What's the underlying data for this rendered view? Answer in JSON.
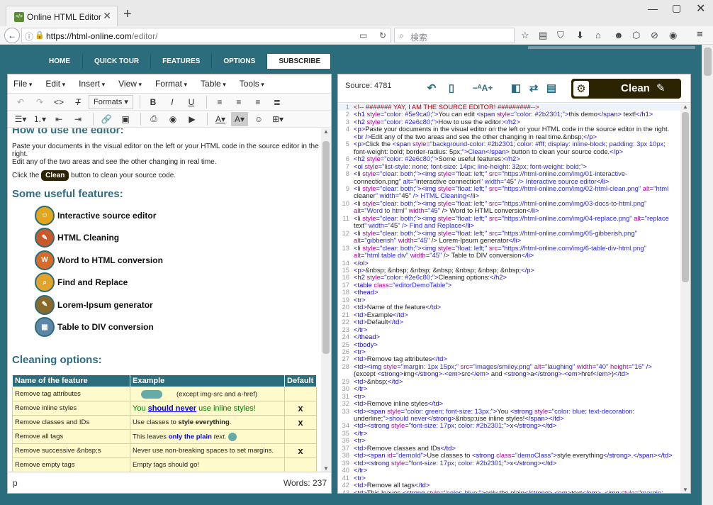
{
  "browser": {
    "tab_title": "Online HTML Editor",
    "url_host": "https://html-online.com",
    "url_path": "/editor/",
    "search_placeholder": "検索"
  },
  "site_nav": [
    "HOME",
    "QUICK TOUR",
    "FEATURES",
    "OPTIONS",
    "SUBSCRIBE"
  ],
  "site_nav_active": "SUBSCRIBE",
  "menubar": [
    "File",
    "Edit",
    "Insert",
    "View",
    "Format",
    "Table",
    "Tools"
  ],
  "toolbar": {
    "formats": "Formats"
  },
  "content": {
    "heading_top": "How to use the editor:",
    "para1": "Paste your documents in the visual editor on the left or your HTML code in the source editor in the right.",
    "para2": "Edit any of the two areas and see the other changing in real time.",
    "click_prefix": "Click the",
    "clean_chip": "Clean",
    "click_suffix": "button to clean your source code.",
    "features_heading": "Some useful features:",
    "features": [
      {
        "label": "Interactive source editor",
        "icon": "interactive-connection-icon"
      },
      {
        "label": "HTML Cleaning",
        "icon": "html-cleaner-icon"
      },
      {
        "label": "Word to HTML conversion",
        "icon": "word-to-html-icon"
      },
      {
        "label": "Find and Replace",
        "icon": "find-replace-icon"
      },
      {
        "label": "Lorem-Ipsum generator",
        "icon": "gibberish-icon"
      },
      {
        "label": "Table to DIV conversion",
        "icon": "table-div-icon"
      }
    ],
    "cleaning_heading": "Cleaning options:",
    "table_headers": [
      "Name of the feature",
      "Example",
      "Default"
    ],
    "table_rows": [
      {
        "name": "Remove tag attributes",
        "example": "(except img-src and a-href)",
        "default": ""
      },
      {
        "name": "Remove inline styles",
        "example_a": "You ",
        "example_b": "should never",
        "example_c": " use inline styles!",
        "default": "x"
      },
      {
        "name": "Remove classes and IDs",
        "example_a": "Use classes to ",
        "example_b": "style everything",
        "example_c": ".",
        "default": "x"
      },
      {
        "name": "Remove all tags",
        "example_a": "This leaves ",
        "example_b": "only the plain",
        "example_c": " text.",
        "default": ""
      },
      {
        "name": "Remove successive &nbsp;s",
        "example": "Never use non-breaking spaces to set margins.",
        "default": "x"
      },
      {
        "name": "Remove empty tags",
        "example": "Empty tags should go!",
        "default": ""
      }
    ],
    "status_path": "p",
    "status_words": "Words: 237"
  },
  "source": {
    "label": "Source: 4781",
    "clean_button": "Clean",
    "lines": [
      "<!-- #######  YAY, I AM THE SOURCE EDITOR! #########-->",
      "<h1 style=\"color: #5e9ca0;\">You can edit <span style=\"color: #2b2301;\">this demo</span> text!</h1>",
      "<h2 style=\"color: #2e6c80;\">How to use the editor:</h2>",
      "<p>Paste your documents in the visual editor on the left or your HTML code in the source editor in the right.",
      "<br />Edit any of the two areas and see the other changing in real time.&nbsp;</p>",
      "<p>Click the <span style=\"background-color: #2b2301; color: #fff; display: inline-block; padding: 3px 10px;",
      "font-weight: bold; border-radius: 5px;\">Clean</span> button to clean your source code.</p>",
      "<h2 style=\"color: #2e6c80;\">Some useful features:</h2>",
      "<ol style=\"list-style: none; font-size: 14px; line-height: 32px; font-weight: bold;\">",
      "<li style=\"clear: both;\"><img style=\"float: left;\" src=\"https://html-online.com/img/01-interactive-",
      "connection.png\" alt=\"interactive connection\" width=\"45\" /> Interactive source editor</li>",
      "<li style=\"clear: both;\"><img style=\"float: left;\" src=\"https://html-online.com/img/02-html-clean.png\" alt=\"html",
      "cleaner\" width=\"45\" /> HTML Cleaning</li>",
      "<li style=\"clear: both;\"><img style=\"float: left;\" src=\"https://html-online.com/img/03-docs-to-html.png\"",
      "alt=\"Word to html\" width=\"45\" /> Word to HTML conversion</li>",
      "<li style=\"clear: both;\"><img style=\"float: left;\" src=\"https://html-online.com/img/04-replace.png\" alt=\"replace",
      "text\" width=\"45\" /> Find and Replace</li>",
      "<li style=\"clear: both;\"><img style=\"float: left;\" src=\"https://html-online.com/img/05-gibberish.png\"",
      "alt=\"gibberish\" width=\"45\" /> Lorem-Ipsum generator</li>",
      "<li style=\"clear: both;\"><img style=\"float: left;\" src=\"https://html-online.com/img/6-table-div-html.png\"",
      "alt=\"html table div\" width=\"45\" /> Table to DIV conversion</li>",
      "</ol>",
      "<p>&nbsp; &nbsp; &nbsp; &nbsp; &nbsp; &nbsp; &nbsp;</p>",
      "<h2 style=\"color: #2e6c80;\">Cleaning options:</h2>",
      "<table class=\"editorDemoTable\">",
      "<thead>",
      "<tr>",
      "<td>Name of the feature</td>",
      "<td>Example</td>",
      "<td>Default</td>",
      "</tr>",
      "</thead>",
      "<tbody>",
      "<tr>",
      "<td>Remove tag attributes</td>",
      "<td><img style=\"margin: 1px 15px;\" src=\"images/smiley.png\" alt=\"laughing\" width=\"40\" height=\"16\" />",
      "(except <strong>img</strong>-<em>src</em> and <strong>a</strong>-<em>href</em>)</td>",
      "<td>&nbsp;</td>",
      "</tr>",
      "<tr>",
      "<td>Remove inline styles</td>",
      "<td><span style=\"color: green; font-size: 13px;\">You <strong style=\"color: blue; text-decoration:",
      "underline;\">should never</strong>&nbsp;use inline styles!</span></td>",
      "<td><strong style=\"font-size: 17px; color: #2b2301;\">x</strong></td>",
      "</tr>",
      "<tr>",
      "<td>Remove classes and IDs</td>",
      "<td><span id=\"demoId\">Use classes to <strong class=\"demoClass\">style everything</strong>.</span></td>",
      "<td><strong style=\"font-size: 17px; color: #2b2301;\">x</strong></td>",
      "</tr>",
      "<tr>",
      "<td>Remove all tags</td>",
      "<td>This leaves <strong style=\"color: blue;\">only the plain</strong> <em>text</em>. <img style=\"margin:"
    ],
    "line_numbers": [
      "1",
      "2",
      "3",
      "4",
      "",
      "5",
      "",
      "6",
      "7",
      "8",
      "",
      "9",
      "",
      "10",
      "",
      "11",
      "",
      "12",
      "",
      "13",
      "",
      "14",
      "15",
      "16",
      "17",
      "18",
      "19",
      "20",
      "21",
      "22",
      "23",
      "24",
      "25",
      "26",
      "27",
      "28",
      "",
      "29",
      "30",
      "31",
      "32",
      "33",
      "",
      "34",
      "35",
      "36",
      "37",
      "38",
      "39",
      "40",
      "41",
      "42",
      "43"
    ]
  },
  "colors": {
    "teal": "#2b6d7c",
    "dark_brown": "#2b2301",
    "table_bg": "#fffacc"
  }
}
